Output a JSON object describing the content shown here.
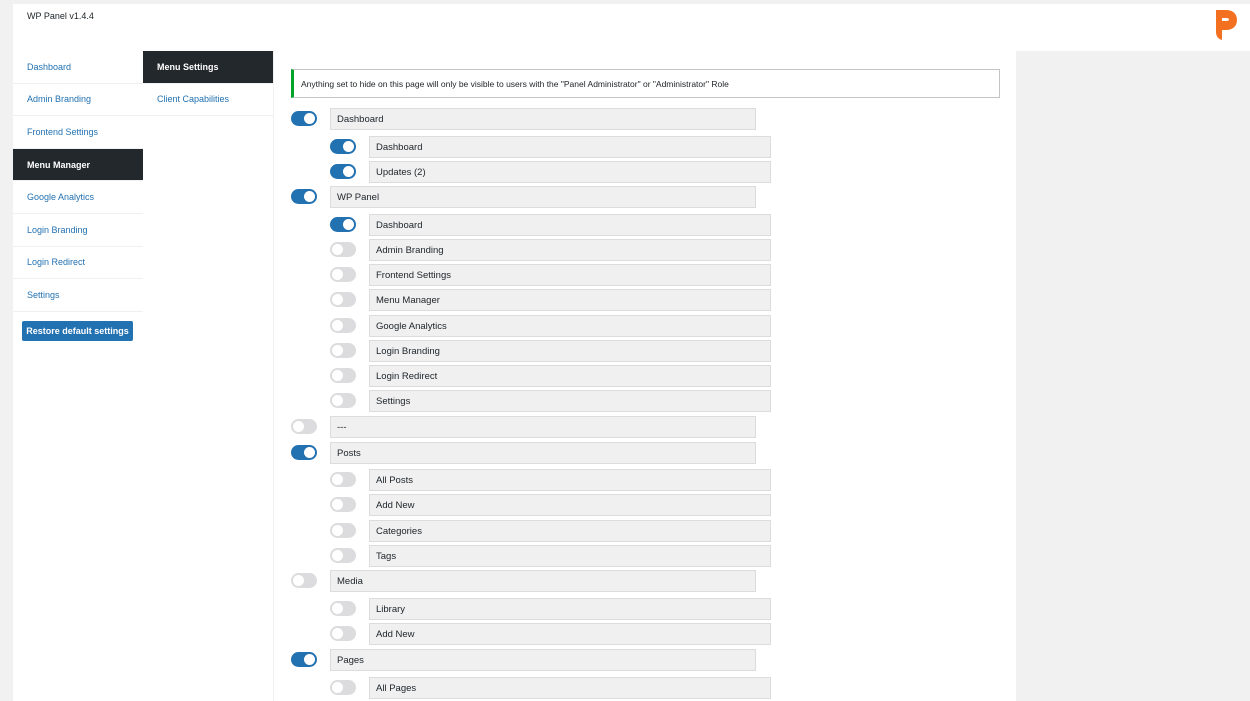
{
  "app": {
    "title": "WP Panel v1.4.4"
  },
  "sidebar": {
    "items": [
      {
        "label": "Dashboard",
        "active": false
      },
      {
        "label": "Admin Branding",
        "active": false
      },
      {
        "label": "Frontend Settings",
        "active": false
      },
      {
        "label": "Menu Manager",
        "active": true
      },
      {
        "label": "Google Analytics",
        "active": false
      },
      {
        "label": "Login Branding",
        "active": false
      },
      {
        "label": "Login Redirect",
        "active": false
      },
      {
        "label": "Settings",
        "active": false
      }
    ],
    "restore_label": "Restore default settings"
  },
  "subnav": {
    "items": [
      {
        "label": "Menu Settings",
        "active": true
      },
      {
        "label": "Client Capabilities",
        "active": false
      }
    ]
  },
  "notice": "Anything set to hide on this page will only be visible to users with the \"Panel Administrator\" or \"Administrator\" Role",
  "menu_rows": [
    {
      "label": "Dashboard",
      "level": 0,
      "on": true
    },
    {
      "label": "Dashboard",
      "level": 1,
      "on": true
    },
    {
      "label": "Updates (2)",
      "level": 1,
      "on": true
    },
    {
      "label": "WP Panel",
      "level": 0,
      "on": true
    },
    {
      "label": "Dashboard",
      "level": 1,
      "on": true
    },
    {
      "label": "Admin Branding",
      "level": 1,
      "on": false
    },
    {
      "label": "Frontend Settings",
      "level": 1,
      "on": false
    },
    {
      "label": "Menu Manager",
      "level": 1,
      "on": false
    },
    {
      "label": "Google Analytics",
      "level": 1,
      "on": false
    },
    {
      "label": "Login Branding",
      "level": 1,
      "on": false
    },
    {
      "label": "Login Redirect",
      "level": 1,
      "on": false
    },
    {
      "label": "Settings",
      "level": 1,
      "on": false
    },
    {
      "label": "---",
      "level": 0,
      "on": false
    },
    {
      "label": "Posts",
      "level": 0,
      "on": true
    },
    {
      "label": "All Posts",
      "level": 1,
      "on": false
    },
    {
      "label": "Add New",
      "level": 1,
      "on": false
    },
    {
      "label": "Categories",
      "level": 1,
      "on": false
    },
    {
      "label": "Tags",
      "level": 1,
      "on": false
    },
    {
      "label": "Media",
      "level": 0,
      "on": false
    },
    {
      "label": "Library",
      "level": 1,
      "on": false
    },
    {
      "label": "Add New",
      "level": 1,
      "on": false
    },
    {
      "label": "Pages",
      "level": 0,
      "on": true
    },
    {
      "label": "All Pages",
      "level": 1,
      "on": false
    }
  ],
  "colors": {
    "accent": "#2271b1",
    "sidebar_active": "#23282d",
    "logo": "#f37021"
  }
}
